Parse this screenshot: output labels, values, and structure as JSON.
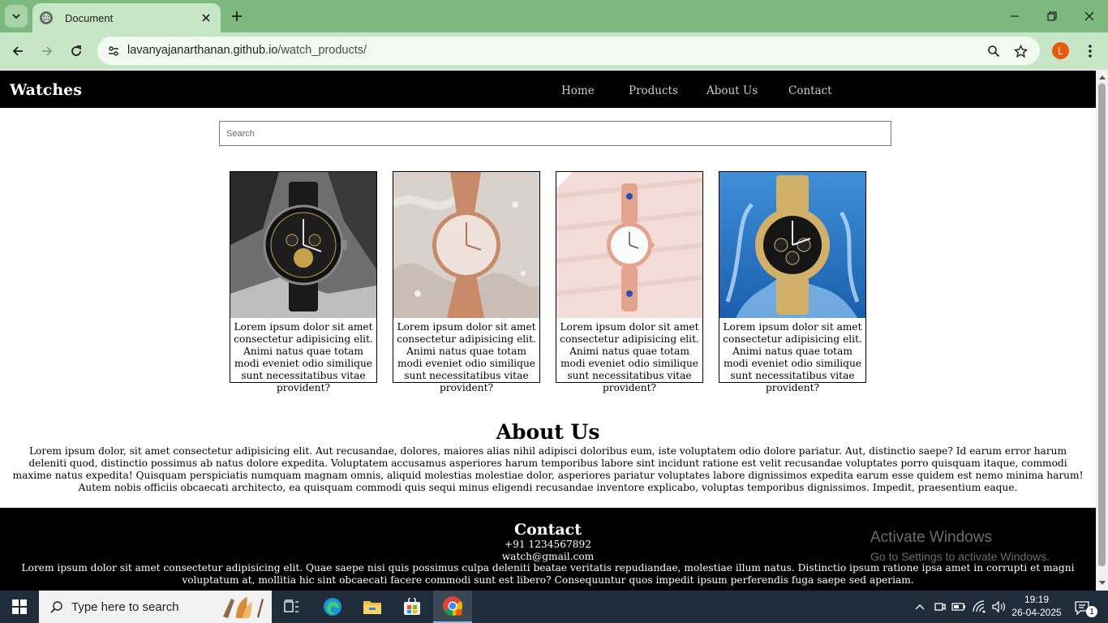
{
  "browser": {
    "tab_title": "Document",
    "url_host": "lavanyajanarthanan.github.io",
    "url_path": "/watch_products/",
    "profile_initial": "L"
  },
  "site": {
    "brand": "Watches",
    "nav": [
      "Home",
      "Products",
      "About Us",
      "Contact"
    ],
    "search_placeholder": "Search",
    "products": [
      {
        "text": "Lorem ipsum dolor sit amet consectetur adipisicing elit. Animi natus quae totam modi eveniet odio similique sunt necessitatibus vitae provident?",
        "image": "black-chronograph-watch"
      },
      {
        "text": "Lorem ipsum dolor sit amet consectetur adipisicing elit. Animi natus quae totam modi eveniet odio similique sunt necessitatibus vitae provident?",
        "image": "rose-gold-mesh-watch"
      },
      {
        "text": "Lorem ipsum dolor sit amet consectetur adipisicing elit. Animi natus quae totam modi eveniet odio similique sunt necessitatibus vitae provident?",
        "image": "pink-bracelet-watch"
      },
      {
        "text": "Lorem ipsum dolor sit amet consectetur adipisicing elit. Animi natus quae totam modi eveniet odio similique sunt necessitatibus vitae provident?",
        "image": "gold-chronograph-watch"
      }
    ],
    "about": {
      "title": "About Us",
      "text": "Lorem ipsum dolor, sit amet consectetur adipisicing elit. Aut recusandae, dolores, maiores alias nihil adipisci doloribus eum, iste voluptatem odio dolore pariatur. Aut, distinctio saepe? Id earum error harum deleniti quod, distinctio possimus ab natus dolore expedita. Voluptatem accusamus asperiores harum temporibus labore sint incidunt ratione est velit recusandae voluptates porro quisquam itaque, commodi maxime natus expedita! Quisquam perspiciatis numquam magnam omnis, aliquid molestias molestiae dolor, asperiores pariatur voluptates labore dignissimos expedita earum esse quidem est nemo minima harum! Autem nobis officiis obcaecati architecto, ea quisquam commodi quis sequi minus eligendi recusandae inventore explicabo, voluptas temporibus dignissimos. Impedit, praesentium eaque."
    },
    "contact": {
      "title": "Contact",
      "phone": "+91 1234567892",
      "email": "watch@gmail.com",
      "text": "Lorem ipsum dolor sit amet consectetur adipisicing elit. Quae saepe nisi quis possimus culpa deleniti beatae veritatis repudiandae, molestiae illum natus. Distinctio ipsum ratione ipsa amet in corrupti et magni voluptatum at, mollitia hic sint obcaecati facere commodi sunt est libero? Consequuntur quos impedit ipsum perferendis fuga saepe sed aperiam."
    }
  },
  "watermark": {
    "line1": "Activate Windows",
    "line2": "Go to Settings to activate Windows."
  },
  "taskbar": {
    "search_placeholder": "Type here to search",
    "time": "19:19",
    "date": "26-04-2025",
    "notification_count": "1",
    "apps": [
      "task-view",
      "edge",
      "file-explorer",
      "microsoft-store",
      "chrome"
    ]
  },
  "colors": {
    "tabbar": "#7db87e",
    "toolbar": "#c7e6c5",
    "site_nav": "#000000",
    "footer": "#000000",
    "taskbar": "#1f2d3a"
  }
}
